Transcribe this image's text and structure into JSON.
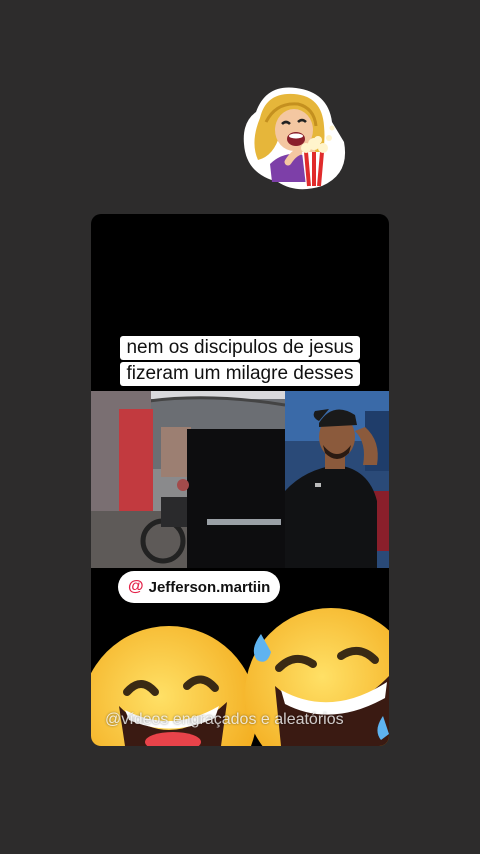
{
  "post": {
    "caption_line1": "nem os discipulos de jesus",
    "caption_line2": "fizeram um milagre desses",
    "mention_symbol": "@",
    "mention_handle": "Jefferson.martiin",
    "watermark": "@vídeos engraçados e aleatórios"
  },
  "sticker": {
    "icon": "popcorn-girl-sticker"
  },
  "colors": {
    "page_background": "#2d2c2c",
    "post_background": "#000000",
    "mention_accent": "#e4234a",
    "emoji_yellow": "#f7c62a"
  }
}
